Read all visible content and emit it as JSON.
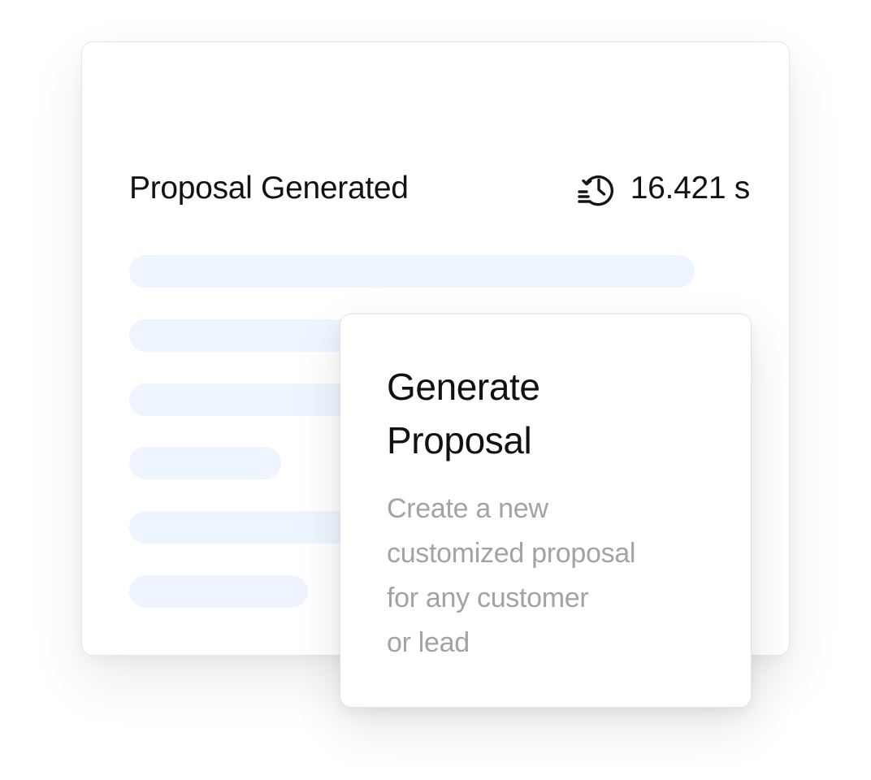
{
  "result_card": {
    "title": "Proposal Generated",
    "elapsed_time": "16.421 s",
    "icon": "history-clock-icon",
    "placeholder_color": "#eef5fe"
  },
  "action_card": {
    "title": "Generate\nProposal",
    "description": "Create a new\ncustomized proposal\nfor any customer\nor lead"
  }
}
